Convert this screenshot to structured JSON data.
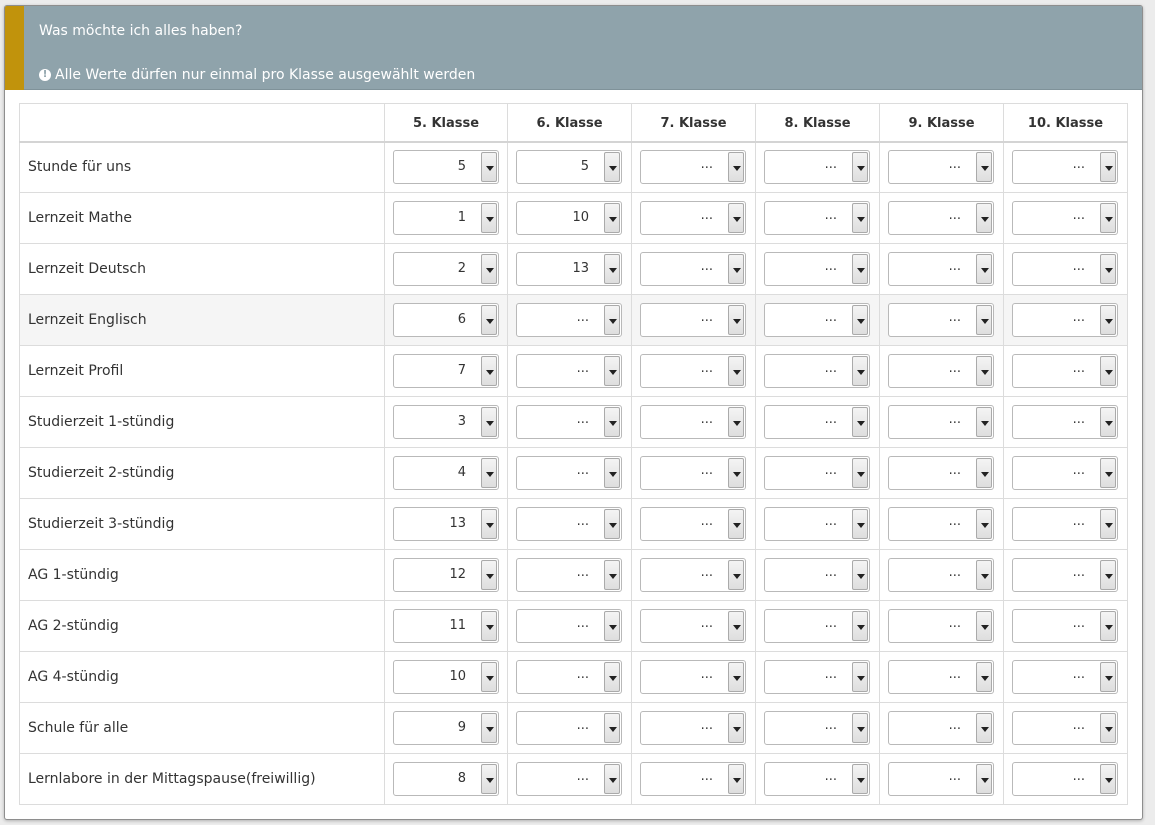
{
  "header": {
    "title": "Was möchte ich alles haben?",
    "note": "Alle Werte dürfen nur einmal pro Klasse ausgewählt werden",
    "accent_color": "#c1930c",
    "background_color": "#8fa3ab",
    "note_icon": "info-circle-icon"
  },
  "table": {
    "columns": [
      "5. Klasse",
      "6. Klasse",
      "7. Klasse",
      "8. Klasse",
      "9. Klasse",
      "10. Klasse"
    ],
    "empty_label": "...",
    "rows": [
      {
        "label": "Stunde für uns",
        "values": [
          "5",
          "5",
          "...",
          "...",
          "...",
          "..."
        ]
      },
      {
        "label": "Lernzeit Mathe",
        "values": [
          "1",
          "10",
          "...",
          "...",
          "...",
          "..."
        ]
      },
      {
        "label": "Lernzeit Deutsch",
        "values": [
          "2",
          "13",
          "...",
          "...",
          "...",
          "..."
        ]
      },
      {
        "label": "Lernzeit Englisch",
        "values": [
          "6",
          "...",
          "...",
          "...",
          "...",
          "..."
        ]
      },
      {
        "label": "Lernzeit Profil",
        "values": [
          "7",
          "...",
          "...",
          "...",
          "...",
          "..."
        ]
      },
      {
        "label": "Studierzeit 1-stündig",
        "values": [
          "3",
          "...",
          "...",
          "...",
          "...",
          "..."
        ]
      },
      {
        "label": "Studierzeit 2-stündig",
        "values": [
          "4",
          "...",
          "...",
          "...",
          "...",
          "..."
        ]
      },
      {
        "label": "Studierzeit 3-stündig",
        "values": [
          "13",
          "...",
          "...",
          "...",
          "...",
          "..."
        ]
      },
      {
        "label": "AG 1-stündig",
        "values": [
          "12",
          "...",
          "...",
          "...",
          "...",
          "..."
        ]
      },
      {
        "label": "AG 2-stündig",
        "values": [
          "11",
          "...",
          "...",
          "...",
          "...",
          "..."
        ]
      },
      {
        "label": "AG 4-stündig",
        "values": [
          "10",
          "...",
          "...",
          "...",
          "...",
          "..."
        ]
      },
      {
        "label": "Schule für alle",
        "values": [
          "9",
          "...",
          "...",
          "...",
          "...",
          "..."
        ]
      },
      {
        "label": "Lernlabore in der Mittagspause(freiwillig)",
        "values": [
          "8",
          "...",
          "...",
          "...",
          "...",
          "..."
        ]
      }
    ]
  }
}
